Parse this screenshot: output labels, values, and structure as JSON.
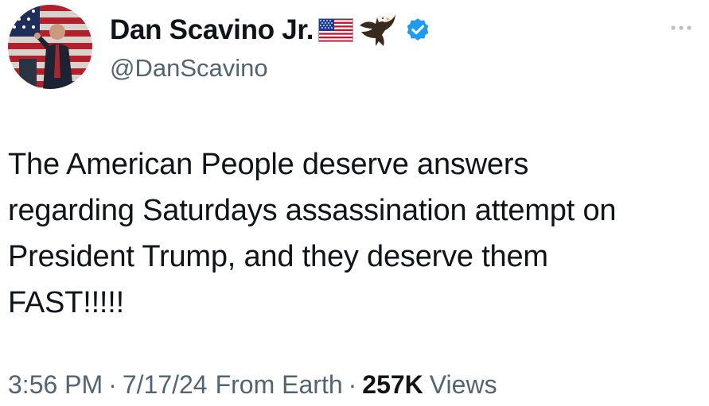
{
  "author": {
    "display_name": "Dan Scavino Jr.",
    "handle": "@DanScavino",
    "name_icons": [
      "us-flag-icon",
      "eagle-icon",
      "verified-badge-icon"
    ],
    "avatar_description_icon": "avatar-photo"
  },
  "tweet": {
    "text": "The American People deserve answers\nregarding Saturdays assassination attempt on\nPresident Trump, and they deserve them\nFAST!!!!!"
  },
  "meta": {
    "time": "3:56 PM",
    "separator": "·",
    "date": "7/17/24",
    "source": "From Earth",
    "views_count": "257K",
    "views_label": "Views"
  },
  "colors": {
    "text_primary": "#0f1419",
    "text_secondary": "#536471",
    "verified_blue": "#1d9bf0",
    "background": "#ffffff"
  },
  "more_icon": "more-horizontal-icon"
}
